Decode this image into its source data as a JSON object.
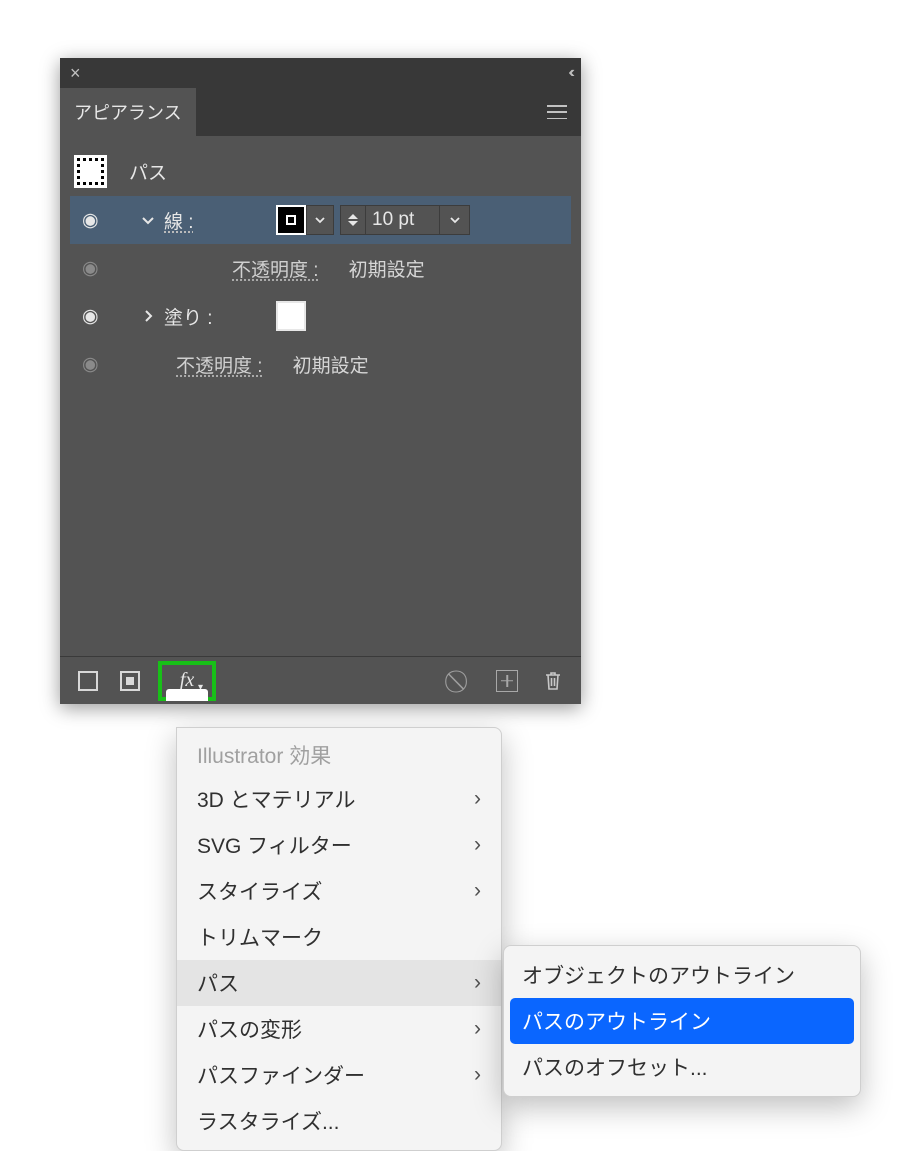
{
  "panel": {
    "tab_title": "アピアランス",
    "title_row": {
      "label": "パス"
    },
    "stroke": {
      "label": "線 :",
      "value": "10 pt"
    },
    "stroke_opacity": {
      "label": "不透明度 :",
      "value": "初期設定"
    },
    "fill": {
      "label": "塗り :"
    },
    "fill_opacity": {
      "label": "不透明度 :",
      "value": "初期設定"
    },
    "fx_label": "fx"
  },
  "menu": {
    "header": "Illustrator 効果",
    "items": [
      {
        "label": "3D とマテリアル",
        "has_sub": true
      },
      {
        "label": "SVG フィルター",
        "has_sub": true
      },
      {
        "label": "スタイライズ",
        "has_sub": true
      },
      {
        "label": "トリムマーク",
        "has_sub": false
      },
      {
        "label": "パス",
        "has_sub": true,
        "hover": true
      },
      {
        "label": "パスの変形",
        "has_sub": true
      },
      {
        "label": "パスファインダー",
        "has_sub": true
      },
      {
        "label": "ラスタライズ...",
        "has_sub": false
      }
    ]
  },
  "submenu": {
    "items": [
      {
        "label": "オブジェクトのアウトライン"
      },
      {
        "label": "パスのアウトライン",
        "selected": true
      },
      {
        "label": "パスのオフセット..."
      }
    ]
  }
}
